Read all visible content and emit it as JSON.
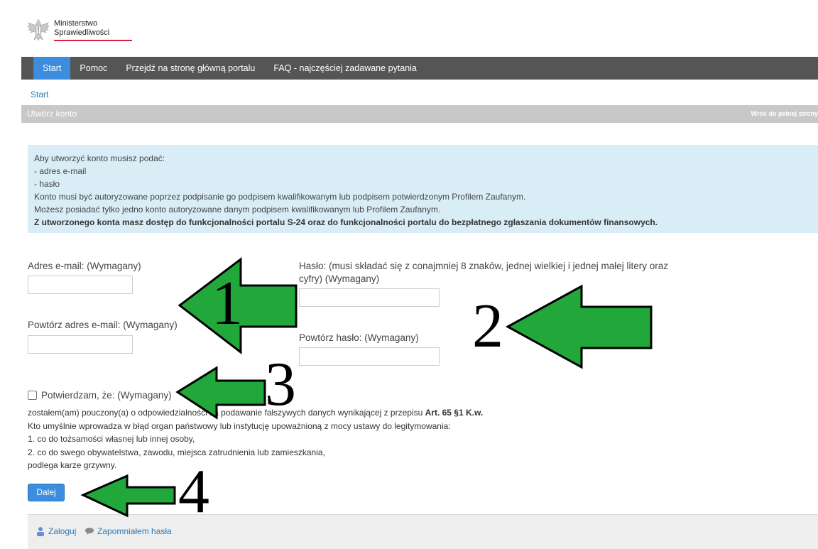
{
  "logo": {
    "line1": "Ministerstwo",
    "line2": "Sprawiedliwości",
    "accent_color": "#d4213d"
  },
  "nav": {
    "items": [
      {
        "label": "Start",
        "active": true
      },
      {
        "label": "Pomoc"
      },
      {
        "label": "Przejdź na stronę główną portalu"
      },
      {
        "label": "FAQ - najczęściej zadawane pytania"
      }
    ]
  },
  "breadcrumb": "Start",
  "section": {
    "title": "Utwórz konto",
    "back_link": "Wróć do pełnej strony"
  },
  "info": {
    "lines": [
      "Aby utworzyć konto musisz podać:",
      "- adres e-mail",
      "- hasło",
      "Konto musi być autoryzowane poprzez podpisanie go podpisem kwalifikowanym lub podpisem potwierdzonym Profilem Zaufanym.",
      "Możesz posiadać tylko jedno konto autoryzowane danym podpisem kwalifikowanym lub Profilem Zaufanym."
    ],
    "bold_line": "Z utworzonego konta masz dostęp do funkcjonalności portalu S-24 oraz do funkcjonalności portalu do bezpłatnego zgłaszania dokumentów finansowych."
  },
  "form": {
    "email_label": "Adres e-mail: (Wymagany)",
    "email_repeat_label": "Powtórz adres e-mail: (Wymagany)",
    "password_label_line1": "Hasło: (musi składać się z conajmniej 8 znaków, jednej wielkiej i jednej małej litery oraz",
    "password_label_line2": "cyfry) (Wymagany)",
    "password_repeat_label": "Powtórz hasło: (Wymagany)",
    "email_value": "",
    "email_repeat_value": "",
    "password_value": "",
    "password_repeat_value": ""
  },
  "confirm": {
    "label": "Potwierdzam, że: (Wymagany)",
    "line1_text": "zostałem(am) pouczony(a) o odpowiedzialności za podawanie fałszywych danych wynikającej z przepisu ",
    "line1_bold": "Art. 65 §1 K.w.",
    "lines": [
      "Kto umyślnie wprowadza w błąd organ państwowy lub instytucję upoważnioną z mocy ustawy do legitymowania:",
      "1. co do tożsamości własnej lub innej osoby,",
      "2. co do swego obywatelstwa, zawodu, miejsca zatrudnienia lub zamieszkania,",
      "podlega karze grzywny."
    ]
  },
  "buttons": {
    "next": "Dalej"
  },
  "footer": {
    "login": "Zaloguj",
    "forgot": "Zapomniałem hasła"
  },
  "annotations": {
    "n1": "1",
    "n2": "2",
    "n3": "3",
    "n4": "4",
    "arrow_color": "#22a83a"
  },
  "colors": {
    "nav_bg": "#555555",
    "nav_active": "#3c8dde",
    "info_bg": "#d9edf7",
    "link": "#2a7ab8"
  }
}
